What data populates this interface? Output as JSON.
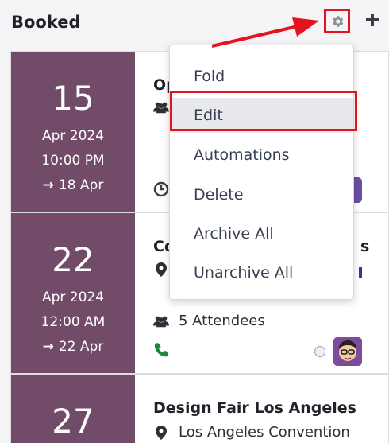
{
  "column": {
    "title": "Booked",
    "settings_icon": "gear-icon",
    "add_icon": "plus-icon"
  },
  "cards": [
    {
      "day": "15",
      "month": "Apr 2024",
      "time": "10:00 PM",
      "until": "18 Apr",
      "title": "Op",
      "attendees_icon": "users-icon",
      "activity_icon": "clock-icon"
    },
    {
      "day": "22",
      "month": "Apr 2024",
      "time": "12:00 AM",
      "until": "22 Apr",
      "title": "Co",
      "title_tail": "s",
      "location_icon": "map-marker-icon",
      "attendees": "5 Attendees",
      "phone_icon": "phone-icon"
    },
    {
      "day": "27",
      "title": "Design Fair Los Angeles",
      "location": "Los Angeles Convention"
    }
  ],
  "menu": {
    "items": [
      {
        "label": "Fold"
      },
      {
        "label": "Edit"
      },
      {
        "label": "Automations"
      },
      {
        "label": "Delete"
      },
      {
        "label": "Archive All"
      },
      {
        "label": "Unarchive All"
      }
    ]
  },
  "colors": {
    "date_block": "#714b67",
    "highlight": "#e3141f",
    "phone": "#1a8a3a"
  }
}
